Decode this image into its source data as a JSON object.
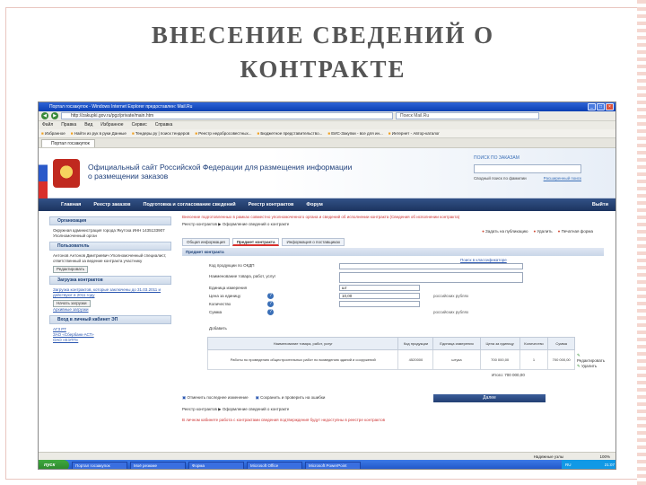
{
  "slide": {
    "title_line1": "ВНЕСЕНИЕ СВЕДЕНИЙ О",
    "title_line2": "КОНТРАКТЕ"
  },
  "browser": {
    "window_title": "Портал госзакупок - Windows Internet Explorer предоставлен: Mail.Ru",
    "address": "http://zakupki.gov.ru/pgz/private/main.htm",
    "search_placeholder": "Поиск Mail.Ru",
    "menu": [
      "Файл",
      "Правка",
      "Вид",
      "Избранное",
      "Сервис",
      "Справка"
    ],
    "favorites": [
      "Избранное",
      "Найти из рук в руки Данные",
      "Тендеры.ру | поиск тендеров",
      "Реестр недобросовестных...",
      "Бюджетное представительство...",
      "ЕИС-Закупки - все для ин...",
      "Интернет - Автор-каталог"
    ],
    "tab": "Портал госзакупок"
  },
  "site": {
    "name": "Официальный сайт Российской Федерации для размещения информации о размещении заказов",
    "search_label": "ПОИСК ПО ЗАКАЗАМ",
    "search_option": "Сводный поиск по фамилии",
    "ext_search": "Расширенный поиск",
    "nav": [
      "Главная",
      "Реестр заказов",
      "Подготовка и согласование сведений",
      "Реестр контрактов",
      "Форум"
    ],
    "exit": "Выйти"
  },
  "left": {
    "org_header": "Организация",
    "org_text": "Окружная администрация города Якутска ИНН 1435133907 Уполномоченный орган",
    "user_header": "Пользователь",
    "user_text": "Антонов Антонов Дмитриевич Уполномоченный специалист, ответственный за ведение контракта участнику",
    "user_btn": "Редактировать",
    "upload_header": "Загрузка контрактов",
    "upload_link": "Загрузка контрактов, которые заключены до 31.03.2011 и действуют в 2011 году",
    "upload_btn": "Начать загрузки",
    "upload_archive": "Архивные загрузки",
    "cabinet_header": "Вход в личный кабинет ЭП",
    "cabinet_items": [
      "АГЗ РТ",
      "ЗАО «Сбербанк-АСТ»",
      "ОАО «ЕЭТП»"
    ]
  },
  "main": {
    "notice": "Внесение подготовленных в рамках совместно уполномоченного органа и сведений об исполнении контракта (Сведения об исполнении контракта)",
    "breadcrumb": "Реестр контрактов ▶ Оформление сведений о контракте",
    "actions": [
      "Задать на публикацию",
      "Удалить",
      "Печатная форма"
    ],
    "tabs": [
      "Общая информация",
      "Предмет контракта",
      "Информация о поставщиках"
    ],
    "section": "Предмет контракта",
    "okdp_label": "Код продукции по ОКДП",
    "name_label": "Наименование товара, работ, услуг",
    "unit_label": "Единица измерения",
    "unit_value": "шт",
    "price_label": "Цена за единицу",
    "price_value": "10,00",
    "qty_label": "Количество",
    "sum_label": "Сумма",
    "rub_note": "российских рублях",
    "okdp_link": "Поиск в классификаторе",
    "add_btn": "Добавить",
    "table_headers": [
      "Наименование товара, работ, услуг",
      "Код продукции",
      "Единица измерения",
      "Цена за единицу",
      "Количество",
      "Сумма"
    ],
    "table_row": [
      "Работы по проведению общестроительных работ по возведению зданий и сооружений",
      "4520000",
      "штука",
      "700 000,00",
      "1",
      "700 000,00"
    ],
    "row_actions": [
      "Редактировать",
      "Удалить"
    ],
    "total": "Итого: 700 000,00",
    "bottom_links": [
      "Отменить последнее изменение",
      "Сохранить и проверить на ошибки"
    ],
    "next_btn": "Далее",
    "bread2": "Реестр контрактов ▶ Оформление сведений о контракте",
    "warn2": "В личном кабинете работа с контрактами сведения подтверждения будут недоступны в реестре контрактов"
  },
  "status": {
    "zone": "Надежные узлы",
    "zoom": "100%"
  },
  "taskbar": {
    "start": "пуск",
    "tasks": [
      "Портал госзакупок",
      "Моё резюме",
      "Форма",
      "Microsoft Office",
      "Microsoft PowerPoint"
    ],
    "clock": "21:07",
    "lang": "RU"
  }
}
